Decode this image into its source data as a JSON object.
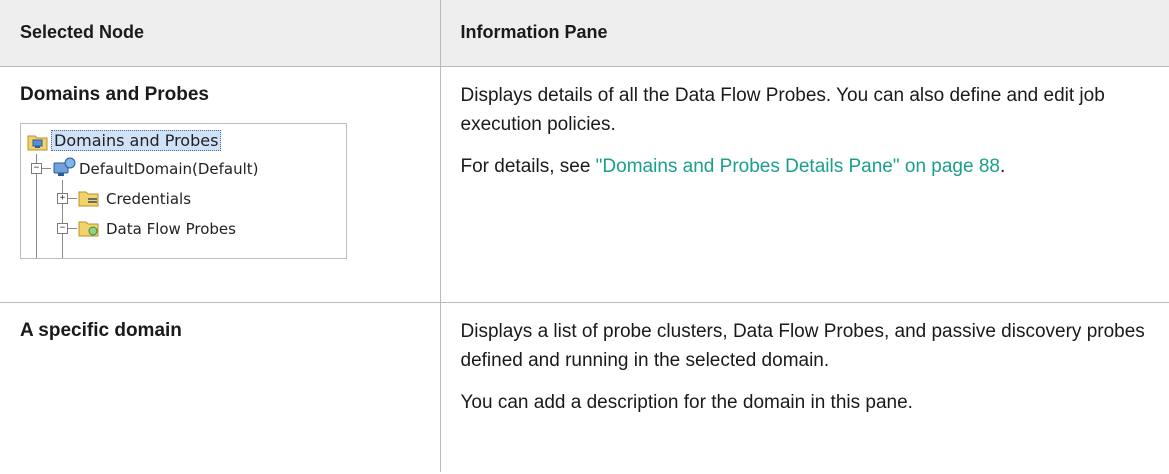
{
  "table": {
    "headers": {
      "selected_node": "Selected Node",
      "information_pane": "Information Pane"
    },
    "rows": [
      {
        "node": "Domains and Probes",
        "info_paragraphs": [
          "Displays details of all the Data Flow Probes. You can also define and edit job execution policies."
        ],
        "details_prefix": "For details, see ",
        "details_link": "\"Domains and Probes Details Pane\" on page 88",
        "details_suffix": ".",
        "tree": {
          "root": "Domains and Probes",
          "domain": "DefaultDomain(Default)",
          "children": [
            "Credentials",
            "Data Flow Probes"
          ],
          "icons": {
            "root": "domains-probes-folder-icon",
            "domain": "domain-computer-icon",
            "credentials": "credentials-folder-icon",
            "probes": "probes-folder-icon"
          }
        }
      },
      {
        "node": "A specific domain",
        "info_paragraphs": [
          "Displays a list of probe clusters, Data Flow Probes, and passive discovery probes defined and running in the selected domain.",
          "You can add a description for the domain in this pane."
        ]
      }
    ]
  },
  "colors": {
    "header_bg": "#eeeeee",
    "border": "#b9b9b9",
    "link": "#1aa08a",
    "tree_selection": "#cfe2f8"
  }
}
